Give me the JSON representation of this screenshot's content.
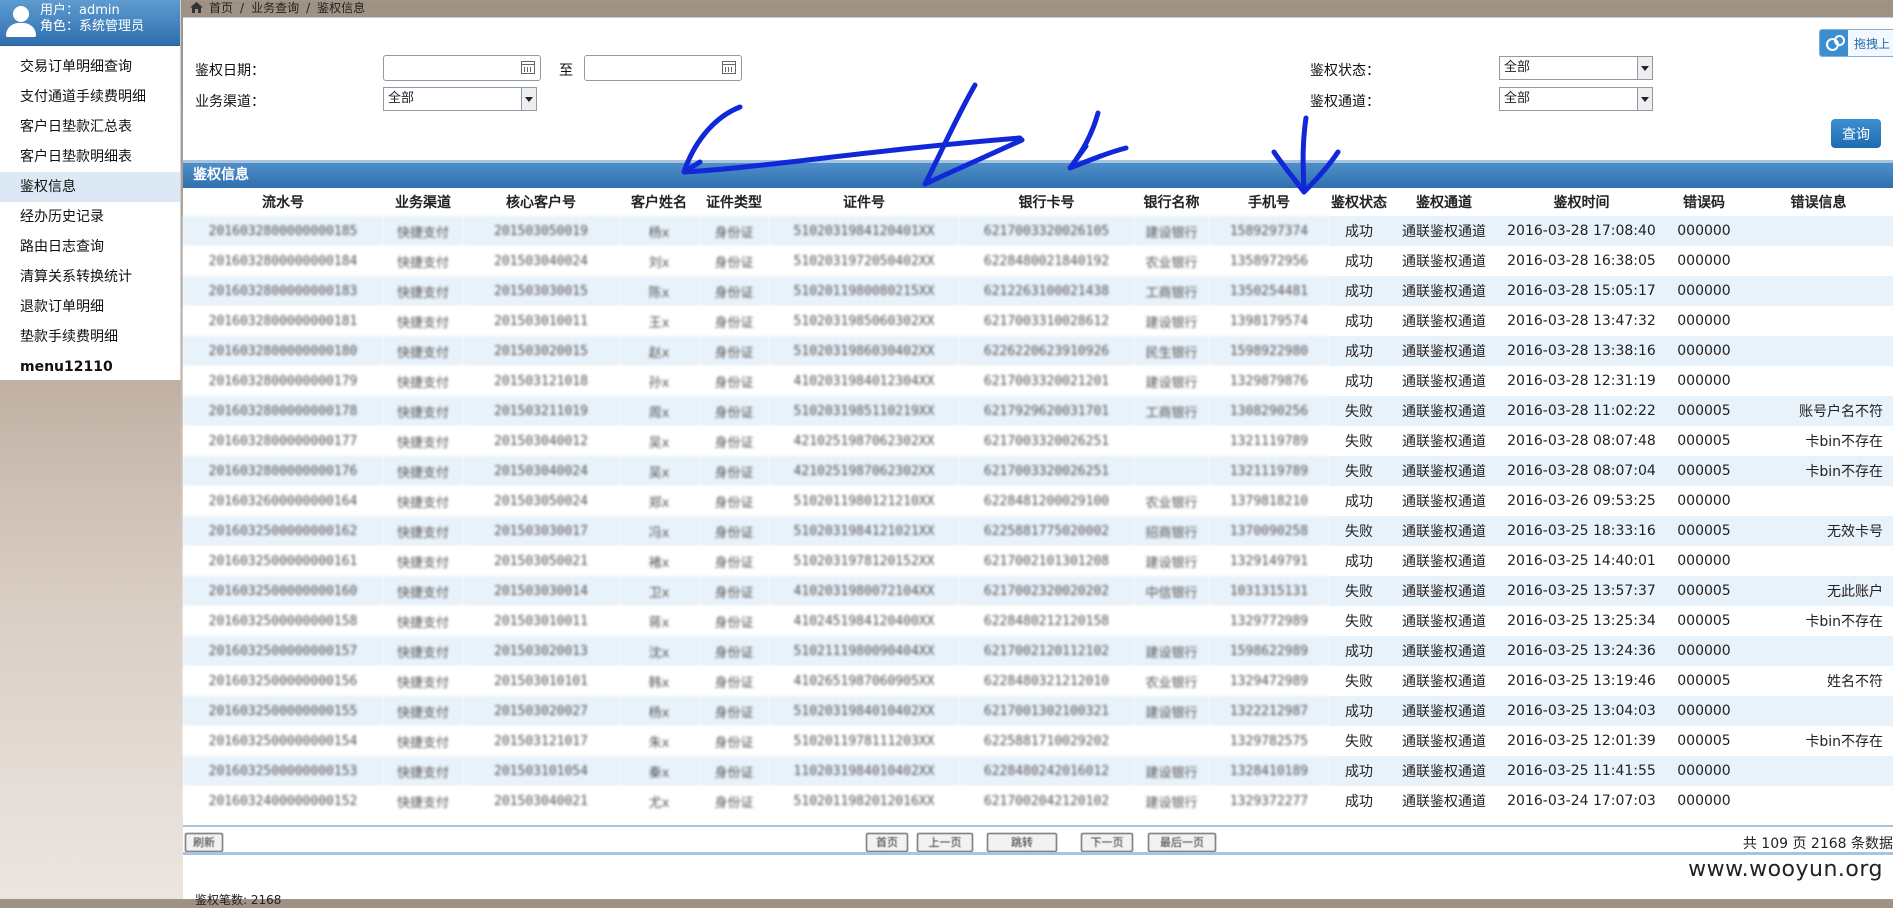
{
  "user": {
    "user_line": "用户：admin",
    "role_line": "角色：系统管理员"
  },
  "menu": [
    "交易订单明细查询",
    "支付通道手续费明细",
    "客户日垫款汇总表",
    "客户日垫款明细表",
    "鉴权信息",
    "经办历史记录",
    "路由日志查询",
    "清算关系转换统计",
    "退款订单明细",
    "垫款手续费明细",
    "menu12110"
  ],
  "breadcrumb": {
    "home": "首页",
    "level1": "业务查询",
    "level2": "鉴权信息"
  },
  "filter": {
    "date_label": "鉴权日期：",
    "date_to": "至",
    "channel_label": "业务渠道：",
    "channel_value": "全部",
    "status_label": "鉴权状态：",
    "status_value": "全部",
    "auth_channel_label": "鉴权通道：",
    "auth_channel_value": "全部",
    "query_button": "查询",
    "drag_button": "拖拽上"
  },
  "grid": {
    "title": "鉴权信息",
    "columns": [
      "流水号",
      "业务渠道",
      "核心客户号",
      "客户姓名",
      "证件类型",
      "证件号",
      "银行卡号",
      "银行名称",
      "手机号",
      "鉴权状态",
      "鉴权通道",
      "鉴权时间",
      "错误码",
      "错误信息"
    ],
    "rows": [
      [
        "2016032800000000185",
        "快捷支付",
        "201503050019",
        "杨x",
        "身份证",
        "5102031984120401XX",
        "6217003320026105",
        "建设银行",
        "1589297374",
        "成功",
        "通联鉴权通道",
        "2016-03-28 17:08:40",
        "000000",
        ""
      ],
      [
        "2016032800000000184",
        "快捷支付",
        "201503040024",
        "刘x",
        "身份证",
        "5102031972050402XX",
        "6228480021840192",
        "农业银行",
        "1358972956",
        "成功",
        "通联鉴权通道",
        "2016-03-28 16:38:05",
        "000000",
        ""
      ],
      [
        "2016032800000000183",
        "快捷支付",
        "201503030015",
        "陈x",
        "身份证",
        "5102011980080215XX",
        "6212263100021438",
        "工商银行",
        "1350254481",
        "成功",
        "通联鉴权通道",
        "2016-03-28 15:05:17",
        "000000",
        ""
      ],
      [
        "2016032800000000181",
        "快捷支付",
        "201503010011",
        "王x",
        "身份证",
        "5102031985060302XX",
        "6217003310028612",
        "建设银行",
        "1398179574",
        "成功",
        "通联鉴权通道",
        "2016-03-28 13:47:32",
        "000000",
        ""
      ],
      [
        "2016032800000000180",
        "快捷支付",
        "201503020015",
        "赵x",
        "身份证",
        "5102031986030402XX",
        "6226220623910926",
        "民生银行",
        "1598922980",
        "成功",
        "通联鉴权通道",
        "2016-03-28 13:38:16",
        "000000",
        ""
      ],
      [
        "2016032800000000179",
        "快捷支付",
        "201503121018",
        "孙x",
        "身份证",
        "4102031984012304XX",
        "6217003320021201",
        "建设银行",
        "1329879876",
        "成功",
        "通联鉴权通道",
        "2016-03-28 12:31:19",
        "000000",
        ""
      ],
      [
        "2016032800000000178",
        "快捷支付",
        "201503211019",
        "周x",
        "身份证",
        "5102031985110219XX",
        "6217929620031701",
        "工商银行",
        "1308290256",
        "失败",
        "通联鉴权通道",
        "2016-03-28 11:02:22",
        "000005",
        "账号户名不符"
      ],
      [
        "2016032800000000177",
        "快捷支付",
        "201503040012",
        "吴x",
        "身份证",
        "4210251987062302XX",
        "6217003320026251",
        "",
        "1321119789",
        "失败",
        "通联鉴权通道",
        "2016-03-28 08:07:48",
        "000005",
        "卡bin不存在"
      ],
      [
        "2016032800000000176",
        "快捷支付",
        "201503040024",
        "吴x",
        "身份证",
        "4210251987062302XX",
        "6217003320026251",
        "",
        "1321119789",
        "失败",
        "通联鉴权通道",
        "2016-03-28 08:07:04",
        "000005",
        "卡bin不存在"
      ],
      [
        "2016032600000000164",
        "快捷支付",
        "201503050024",
        "郑x",
        "身份证",
        "5102011980121210XX",
        "6228481200029100",
        "农业银行",
        "1379818210",
        "成功",
        "通联鉴权通道",
        "2016-03-26 09:53:25",
        "000000",
        ""
      ],
      [
        "2016032500000000162",
        "快捷支付",
        "201503030017",
        "冯x",
        "身份证",
        "5102031984121021XX",
        "6225881775020002",
        "招商银行",
        "1370090258",
        "失败",
        "通联鉴权通道",
        "2016-03-25 18:33:16",
        "000005",
        "无效卡号"
      ],
      [
        "2016032500000000161",
        "快捷支付",
        "201503050021",
        "褚x",
        "身份证",
        "5102031978120152XX",
        "6217002101301208",
        "建设银行",
        "1329149791",
        "成功",
        "通联鉴权通道",
        "2016-03-25 14:40:01",
        "000000",
        ""
      ],
      [
        "2016032500000000160",
        "快捷支付",
        "201503030014",
        "卫x",
        "身份证",
        "4102031980072104XX",
        "6217002320020202",
        "中信银行",
        "1031315131",
        "失败",
        "通联鉴权通道",
        "2016-03-25 13:57:37",
        "000005",
        "无此账户"
      ],
      [
        "2016032500000000158",
        "快捷支付",
        "201503010011",
        "蒋x",
        "身份证",
        "4102451984120400XX",
        "6228480212120158",
        "",
        "1329772989",
        "失败",
        "通联鉴权通道",
        "2016-03-25 13:25:34",
        "000005",
        "卡bin不存在"
      ],
      [
        "2016032500000000157",
        "快捷支付",
        "201503020013",
        "沈x",
        "身份证",
        "5102111980090404XX",
        "6217002120112102",
        "建设银行",
        "1598622989",
        "成功",
        "通联鉴权通道",
        "2016-03-25 13:24:36",
        "000000",
        ""
      ],
      [
        "2016032500000000156",
        "快捷支付",
        "201503010101",
        "韩x",
        "身份证",
        "4102651987060905XX",
        "6228480321212010",
        "农业银行",
        "1329472989",
        "失败",
        "通联鉴权通道",
        "2016-03-25 13:19:46",
        "000005",
        "姓名不符"
      ],
      [
        "2016032500000000155",
        "快捷支付",
        "201503020027",
        "杨x",
        "身份证",
        "5102031984010402XX",
        "6217001302100321",
        "建设银行",
        "1322212987",
        "成功",
        "通联鉴权通道",
        "2016-03-25 13:04:03",
        "000000",
        ""
      ],
      [
        "2016032500000000154",
        "快捷支付",
        "201503121017",
        "朱x",
        "身份证",
        "5102011978111203XX",
        "6225881710029202",
        "",
        "1329782575",
        "失败",
        "通联鉴权通道",
        "2016-03-25 12:01:39",
        "000005",
        "卡bin不存在"
      ],
      [
        "2016032500000000153",
        "快捷支付",
        "201503101054",
        "秦x",
        "身份证",
        "1102031984010402XX",
        "6228480242016012",
        "建设银行",
        "1328410189",
        "成功",
        "通联鉴权通道",
        "2016-03-25 11:41:55",
        "000000",
        ""
      ],
      [
        "2016032400000000152",
        "快捷支付",
        "201503040021",
        "尤x",
        "身份证",
        "5102011982012016XX",
        "6217002042120102",
        "建设银行",
        "1329372277",
        "成功",
        "通联鉴权通道",
        "2016-03-24 17:07:03",
        "000000",
        ""
      ]
    ]
  },
  "pager": {
    "refresh": "刷新",
    "first": "首页",
    "prev": "上一页",
    "goto": "跳转",
    "next": "下一页",
    "last": "最后一页",
    "info": "共 109 页 2168 条数据"
  },
  "footer": {
    "total": "鉴权笔数: 2168",
    "watermark": "www.wooyun.org"
  },
  "colors": {
    "header_blue": "#2f6fae",
    "row_alt": "#e8f2fa",
    "annotation_ink": "#1028d8"
  }
}
